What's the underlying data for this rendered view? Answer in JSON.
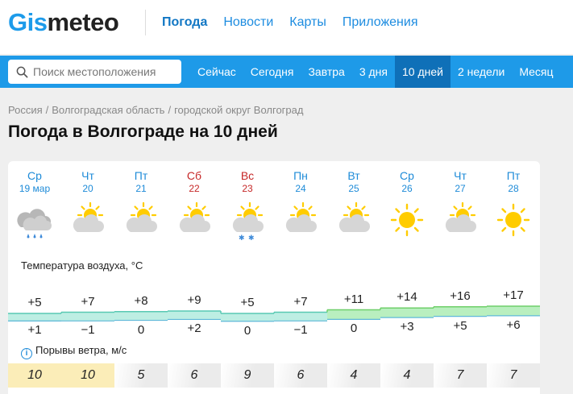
{
  "header": {
    "logo_part1": "Gis",
    "logo_part2": "meteo",
    "nav": [
      "Погода",
      "Новости",
      "Карты",
      "Приложения"
    ]
  },
  "search": {
    "placeholder": "Поиск местоположения"
  },
  "tabs": [
    "Сейчас",
    "Сегодня",
    "Завтра",
    "3 дня",
    "10 дней",
    "2 недели",
    "Месяц"
  ],
  "active_tab": "10 дней",
  "breadcrumb": [
    "Россия",
    "Волгоградская область",
    "городской округ Волгоград"
  ],
  "page_title": "Погода в Волгограде на 10 дней",
  "days": [
    {
      "dow": "Ср",
      "date": "19 мар",
      "weekend": false,
      "icon": "cloud-rain-icon"
    },
    {
      "dow": "Чт",
      "date": "20",
      "weekend": false,
      "icon": "sun-cloud-icon"
    },
    {
      "dow": "Пт",
      "date": "21",
      "weekend": false,
      "icon": "sun-cloud-icon"
    },
    {
      "dow": "Сб",
      "date": "22",
      "weekend": true,
      "icon": "sun-cloud-icon"
    },
    {
      "dow": "Вс",
      "date": "23",
      "weekend": true,
      "icon": "sun-cloud-snow-icon"
    },
    {
      "dow": "Пн",
      "date": "24",
      "weekend": false,
      "icon": "sun-cloud-icon"
    },
    {
      "dow": "Вт",
      "date": "25",
      "weekend": false,
      "icon": "sun-cloud-icon"
    },
    {
      "dow": "Ср",
      "date": "26",
      "weekend": false,
      "icon": "sun-icon"
    },
    {
      "dow": "Чт",
      "date": "27",
      "weekend": false,
      "icon": "sun-cloud-icon"
    },
    {
      "dow": "Пт",
      "date": "28",
      "weekend": false,
      "icon": "sun-icon"
    }
  ],
  "temperature": {
    "label": "Температура воздуха, °C",
    "max": [
      "+5",
      "+7",
      "+8",
      "+9",
      "+5",
      "+7",
      "+11",
      "+14",
      "+16",
      "+17"
    ],
    "min": [
      "+1",
      "−1",
      "0",
      "+2",
      "0",
      "−1",
      "0",
      "+3",
      "+5",
      "+6"
    ]
  },
  "gusts": {
    "label": "Порывы ветра, м/с",
    "values": [
      "10",
      "10",
      "5",
      "6",
      "9",
      "6",
      "4",
      "4",
      "7",
      "7"
    ]
  },
  "colors": {
    "brand_blue": "#1e9ae8",
    "active_tab": "#0f70b8",
    "weekend_red": "#c62828",
    "gust_strong": "#fbedb8",
    "gust_normal": "#ebebeb"
  }
}
